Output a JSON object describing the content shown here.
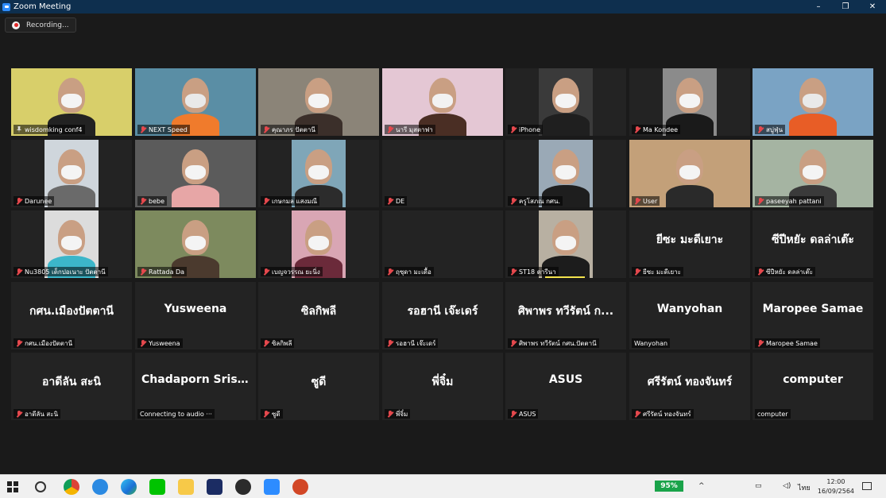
{
  "window": {
    "title": "Zoom Meeting",
    "controls": [
      "–",
      "❐",
      "✕"
    ]
  },
  "recording": {
    "label": "Recording..."
  },
  "participants": [
    {
      "name": "wisdomking conf4",
      "video": true,
      "pinned": true,
      "active": true
    },
    {
      "name": "NEXT Speed",
      "video": true
    },
    {
      "name": "คุณาภร ปัตตานี",
      "video": true
    },
    {
      "name": "นารี มุสตาฟา",
      "video": true
    },
    {
      "name": "iPhone",
      "video": true
    },
    {
      "name": "Ma Kondee",
      "video": true
    },
    {
      "name": "สบู่ฟุ่น",
      "video": true
    },
    {
      "name": "Darunee",
      "video": true
    },
    {
      "name": "bebe",
      "video": true
    },
    {
      "name": "เกษกมล แสงมณี",
      "video": true
    },
    {
      "name": "DE",
      "video": false,
      "display": ""
    },
    {
      "name": "ครูโสภณ กศน.",
      "video": true
    },
    {
      "name": "User",
      "video": true
    },
    {
      "name": "paseeyah pattani",
      "video": true
    },
    {
      "name": "Nu3805 เด็กปอเนาะ ปัตตานี",
      "video": true
    },
    {
      "name": "Rattada Da",
      "video": true
    },
    {
      "name": "เบญจวรรณ ยะนิ่ง",
      "video": true
    },
    {
      "name": "ฤซุดา มะเดื้อ",
      "video": false,
      "display": ""
    },
    {
      "name": "ST18 ดารีนา",
      "video": true,
      "speaking": true
    },
    {
      "name": "ยีซะ มะดีเยาะ",
      "video": false,
      "display": "ยีซะ มะดีเยาะ"
    },
    {
      "name": "ซีปีหยัะ ดลล่าเต๊ะ",
      "video": false,
      "display": "ซีปีหยัะ ดลล่าเต๊ะ"
    },
    {
      "name": "กศน.เมืองปัตตานี",
      "video": false,
      "display": "กศน.เมืองปัตตานี"
    },
    {
      "name": "Yusweena",
      "video": false,
      "display": "Yusweena"
    },
    {
      "name": "ซิลกิพลี",
      "video": false,
      "display": "ซิลกิพลี"
    },
    {
      "name": "รอฮานี เจ๊ะเดร์",
      "video": false,
      "display": "รอฮานี เจ๊ะเดร์"
    },
    {
      "name": "ศิพาพร ทวีรัตน์ กศน.ปัตตานี",
      "video": false,
      "display": "ศิพาพร ทวีรัตน์ ก..."
    },
    {
      "name": "Wanyohan",
      "video": false,
      "display": "Wanyohan",
      "unmuted": true
    },
    {
      "name": "Maropee Samae",
      "video": false,
      "display": "Maropee Samae"
    },
    {
      "name": "อาดีลัน สะนิ",
      "video": false,
      "display": "อาดีลัน สะนิ"
    },
    {
      "name": "Connecting to audio ···",
      "video": false,
      "display": "Chadaporn Sris...",
      "unmuted": true
    },
    {
      "name": "ซูดี",
      "video": false,
      "display": "ซูดี"
    },
    {
      "name": "พี่จิ๋ม",
      "video": false,
      "display": "พี่จิ๋ม"
    },
    {
      "name": "ASUS",
      "video": false,
      "display": "ASUS"
    },
    {
      "name": "ศรีรัตน์ ทองจันทร์",
      "video": false,
      "display": "ศรีรัตน์ ทองจันทร์"
    },
    {
      "name": "computer",
      "video": false,
      "display": "computer",
      "unmuted": true
    }
  ],
  "taskbar": {
    "battery": "95%",
    "language": "ไทย",
    "time": "12:00",
    "date": "16/09/2564"
  }
}
